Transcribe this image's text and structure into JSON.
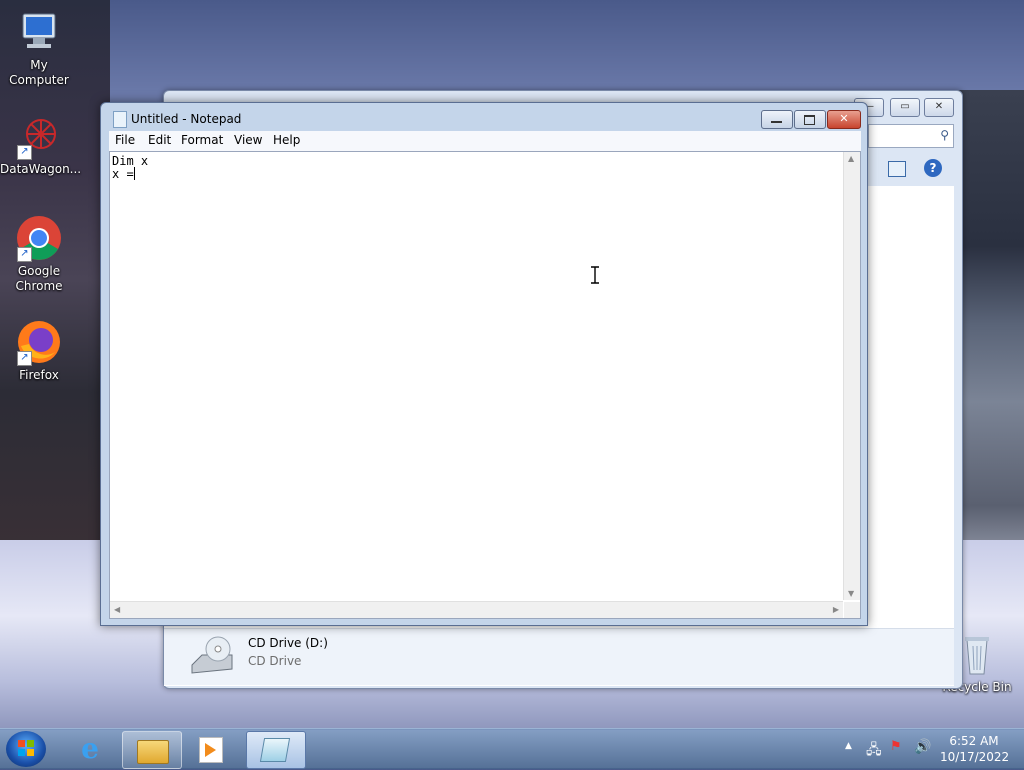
{
  "desktop": {
    "icons": [
      {
        "label": "My Computer"
      },
      {
        "label": "DataWagon..."
      },
      {
        "label": "Google Chrome"
      },
      {
        "label": "Firefox"
      },
      {
        "label": "Recycle Bin"
      }
    ]
  },
  "explorer": {
    "cd_drive": {
      "name": "CD Drive (D:)",
      "type": "CD Drive"
    }
  },
  "notepad": {
    "title": "Untitled - Notepad",
    "menu": [
      "File",
      "Edit",
      "Format",
      "View",
      "Help"
    ],
    "lines": [
      "Dim x",
      "x ="
    ]
  },
  "taskbar": {
    "time": "6:52 AM",
    "date": "10/17/2022"
  }
}
